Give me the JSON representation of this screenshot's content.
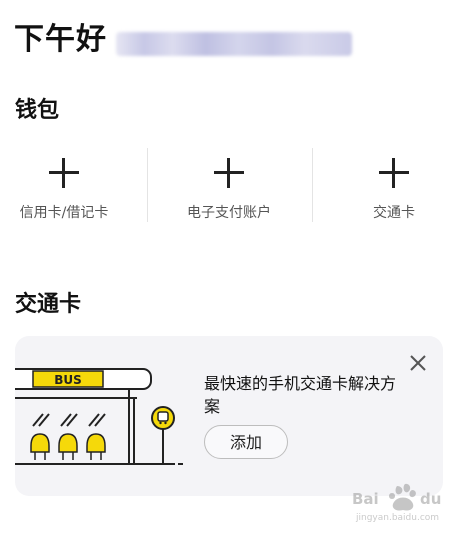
{
  "header": {
    "greeting": "下午好"
  },
  "wallet": {
    "title": "钱包",
    "items": [
      {
        "label": "信用卡/借记卡",
        "icon": "plus-icon"
      },
      {
        "label": "电子支付账户",
        "icon": "plus-icon"
      },
      {
        "label": "交通卡",
        "icon": "plus-icon"
      }
    ]
  },
  "transit": {
    "title": "交通卡",
    "promo": "最快速的手机交通卡解决方案",
    "add_label": "添加",
    "bus_sign": "BUS",
    "close_icon": "close-icon"
  },
  "colors": {
    "accent_yellow": "#f5d90a",
    "card_background": "#f4f4f7",
    "text_primary": "#111111",
    "text_secondary": "#555555"
  }
}
